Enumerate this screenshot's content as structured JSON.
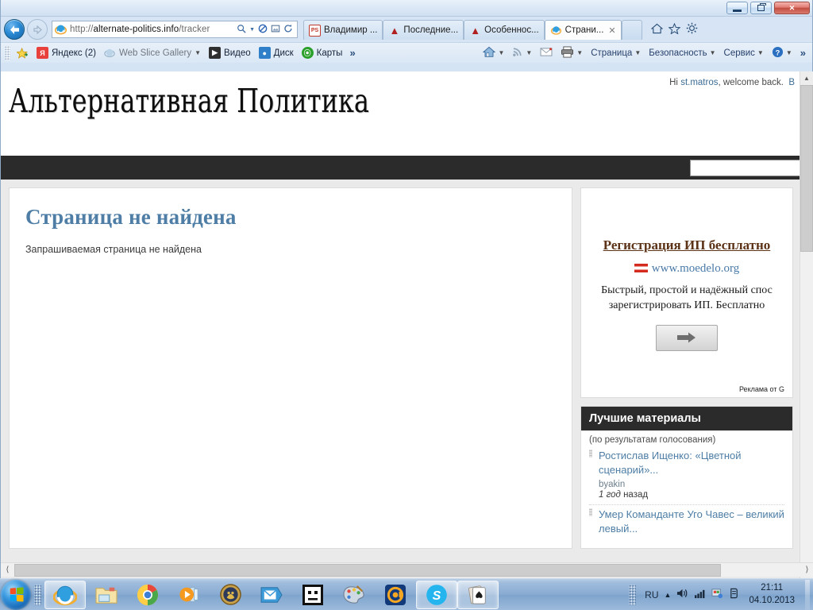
{
  "browser": {
    "window_controls": {
      "minimize": "–",
      "restore": "❐",
      "close": "✕"
    },
    "back_label": "←",
    "forward_label": "→",
    "address": {
      "scheme": "http://",
      "host": "alternate-politics.info",
      "path": "/tracker"
    },
    "address_icons": [
      "search-icon",
      "dropdown-caret",
      "inprivate-filter-icon",
      "compatibility-view-icon",
      "refresh-icon"
    ],
    "tabs": [
      {
        "label": "Владимир ...",
        "icon": "ps-icon",
        "active": false
      },
      {
        "label": "Последние...",
        "icon": "red-a-icon",
        "active": false
      },
      {
        "label": "Особеннос...",
        "icon": "red-a-icon",
        "active": false
      },
      {
        "label": "Страни...",
        "icon": "ie-icon",
        "active": true,
        "close": "✕"
      }
    ],
    "new_tab_label": "",
    "chrome_icons": [
      "home-icon",
      "favorites-star-icon",
      "tools-gear-icon"
    ],
    "favorites": [
      {
        "label": "",
        "icon": "add-favorite-star-icon"
      },
      {
        "label": "Яндекс (2)",
        "icon": "yandex-icon"
      },
      {
        "label": "Web Slice Gallery",
        "icon": "ie-icon",
        "caret": "▼",
        "muted": true
      },
      {
        "label": "Видео",
        "icon": "video-icon"
      },
      {
        "label": "Диск",
        "icon": "disk-icon"
      },
      {
        "label": "Карты",
        "icon": "maps-icon"
      },
      {
        "label": "»",
        "icon": "overflow-chevrons"
      }
    ],
    "command_bar": [
      {
        "label": "",
        "icon": "home-icon",
        "caret": "▼"
      },
      {
        "label": "",
        "icon": "feeds-icon",
        "caret": "▼"
      },
      {
        "label": "",
        "icon": "mail-icon",
        "caret": ""
      },
      {
        "label": "",
        "icon": "print-icon",
        "caret": "▼"
      },
      {
        "label": "Страница",
        "icon": "",
        "caret": "▼"
      },
      {
        "label": "Безопасность",
        "icon": "",
        "caret": "▼"
      },
      {
        "label": "Сервис",
        "icon": "",
        "caret": "▼"
      },
      {
        "label": "",
        "icon": "help-icon",
        "caret": "▼"
      },
      {
        "label": "»",
        "icon": "overflow-chevrons",
        "caret": ""
      }
    ]
  },
  "page": {
    "welcome": {
      "prefix": "Hi ",
      "user": "st.matros",
      "suffix": ", welcome back.",
      "trailing": "В"
    },
    "logo": "Альтернативная Политика",
    "search_placeholder": "",
    "search_value": "",
    "main": {
      "title": "Страница не найдена",
      "text": "Запрашиваемая страница не найдена"
    },
    "ad": {
      "title": "Регистрация ИП бесплатно",
      "url": "www.moedelo.org",
      "desc_line1": "Быстрый, простой и надёжный спос",
      "desc_line2": "зарегистрировать ИП. Бесплатно",
      "button": "➡",
      "byline": "Реклама от G"
    },
    "top_box": {
      "heading": "Лучшие материалы",
      "subheading": "(по результатам голосования)",
      "items": [
        {
          "title": "Ростислав Ищенко: «Цветной сценарий»...",
          "author": "byakin",
          "age_em": "1 год",
          "age_rest": " назад"
        },
        {
          "title": "Умер Команданте Уго Чавес – великий левый...",
          "author": "",
          "age_em": "",
          "age_rest": ""
        }
      ]
    }
  },
  "taskbar": {
    "start_label": "",
    "items": [
      {
        "name": "internet-explorer",
        "active": true
      },
      {
        "name": "windows-explorer",
        "active": false
      },
      {
        "name": "google-chrome",
        "active": false
      },
      {
        "name": "media-player",
        "active": false
      },
      {
        "name": "game-shield",
        "active": false
      },
      {
        "name": "mail-client",
        "active": false
      },
      {
        "name": "face-app",
        "active": false
      },
      {
        "name": "paint",
        "active": false
      },
      {
        "name": "mail-agent",
        "active": false
      },
      {
        "name": "skype",
        "active": true
      },
      {
        "name": "solitaire",
        "active": true
      }
    ],
    "language": "RU",
    "tray_icons": [
      "show-hidden-icons",
      "volume-icon",
      "network-icon",
      "action-center-icon",
      "input-device-icon"
    ],
    "time": "21:11",
    "date": "04.10.2013"
  }
}
